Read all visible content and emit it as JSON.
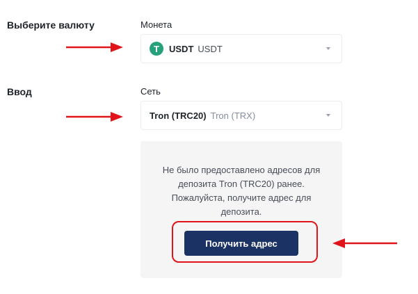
{
  "currency_section": {
    "title": "Выберите валюту",
    "coin_label": "Монета",
    "coin_select": {
      "icon_letter": "T",
      "icon_color": "#26a17b",
      "symbol": "USDT",
      "name": "USDT"
    }
  },
  "deposit_section": {
    "title": "Ввод",
    "network_label": "Сеть",
    "network_select": {
      "name": "Tron (TRC20)",
      "chain": "Tron (TRX)"
    }
  },
  "address_panel": {
    "message": "Не было предоставлено адресов для депозита Tron (TRC20) ранее. Пожалуйста, получите адрес для депозита.",
    "button_label": "Получить адрес"
  },
  "colors": {
    "annotation": "#e1141b",
    "button_bg": "#1b3264",
    "panel_bg": "#f5f5f5"
  }
}
